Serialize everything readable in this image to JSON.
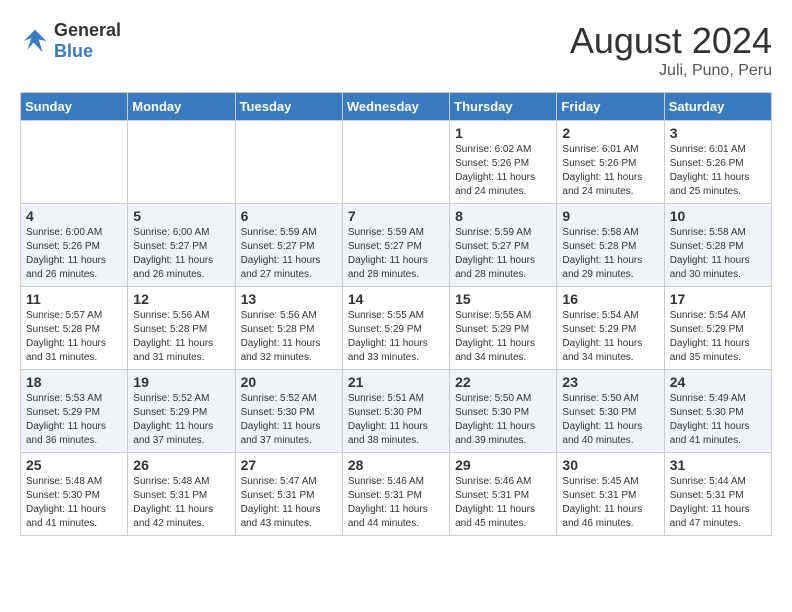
{
  "header": {
    "logo_general": "General",
    "logo_blue": "Blue",
    "month_year": "August 2024",
    "location": "Juli, Puno, Peru"
  },
  "columns": [
    "Sunday",
    "Monday",
    "Tuesday",
    "Wednesday",
    "Thursday",
    "Friday",
    "Saturday"
  ],
  "weeks": [
    [
      {
        "day": "",
        "info": ""
      },
      {
        "day": "",
        "info": ""
      },
      {
        "day": "",
        "info": ""
      },
      {
        "day": "",
        "info": ""
      },
      {
        "day": "1",
        "info": "Sunrise: 6:02 AM\nSunset: 5:26 PM\nDaylight: 11 hours and 24 minutes."
      },
      {
        "day": "2",
        "info": "Sunrise: 6:01 AM\nSunset: 5:26 PM\nDaylight: 11 hours and 24 minutes."
      },
      {
        "day": "3",
        "info": "Sunrise: 6:01 AM\nSunset: 5:26 PM\nDaylight: 11 hours and 25 minutes."
      }
    ],
    [
      {
        "day": "4",
        "info": "Sunrise: 6:00 AM\nSunset: 5:26 PM\nDaylight: 11 hours and 26 minutes."
      },
      {
        "day": "5",
        "info": "Sunrise: 6:00 AM\nSunset: 5:27 PM\nDaylight: 11 hours and 26 minutes."
      },
      {
        "day": "6",
        "info": "Sunrise: 5:59 AM\nSunset: 5:27 PM\nDaylight: 11 hours and 27 minutes."
      },
      {
        "day": "7",
        "info": "Sunrise: 5:59 AM\nSunset: 5:27 PM\nDaylight: 11 hours and 28 minutes."
      },
      {
        "day": "8",
        "info": "Sunrise: 5:59 AM\nSunset: 5:27 PM\nDaylight: 11 hours and 28 minutes."
      },
      {
        "day": "9",
        "info": "Sunrise: 5:58 AM\nSunset: 5:28 PM\nDaylight: 11 hours and 29 minutes."
      },
      {
        "day": "10",
        "info": "Sunrise: 5:58 AM\nSunset: 5:28 PM\nDaylight: 11 hours and 30 minutes."
      }
    ],
    [
      {
        "day": "11",
        "info": "Sunrise: 5:57 AM\nSunset: 5:28 PM\nDaylight: 11 hours and 31 minutes."
      },
      {
        "day": "12",
        "info": "Sunrise: 5:56 AM\nSunset: 5:28 PM\nDaylight: 11 hours and 31 minutes."
      },
      {
        "day": "13",
        "info": "Sunrise: 5:56 AM\nSunset: 5:28 PM\nDaylight: 11 hours and 32 minutes."
      },
      {
        "day": "14",
        "info": "Sunrise: 5:55 AM\nSunset: 5:29 PM\nDaylight: 11 hours and 33 minutes."
      },
      {
        "day": "15",
        "info": "Sunrise: 5:55 AM\nSunset: 5:29 PM\nDaylight: 11 hours and 34 minutes."
      },
      {
        "day": "16",
        "info": "Sunrise: 5:54 AM\nSunset: 5:29 PM\nDaylight: 11 hours and 34 minutes."
      },
      {
        "day": "17",
        "info": "Sunrise: 5:54 AM\nSunset: 5:29 PM\nDaylight: 11 hours and 35 minutes."
      }
    ],
    [
      {
        "day": "18",
        "info": "Sunrise: 5:53 AM\nSunset: 5:29 PM\nDaylight: 11 hours and 36 minutes."
      },
      {
        "day": "19",
        "info": "Sunrise: 5:52 AM\nSunset: 5:29 PM\nDaylight: 11 hours and 37 minutes."
      },
      {
        "day": "20",
        "info": "Sunrise: 5:52 AM\nSunset: 5:30 PM\nDaylight: 11 hours and 37 minutes."
      },
      {
        "day": "21",
        "info": "Sunrise: 5:51 AM\nSunset: 5:30 PM\nDaylight: 11 hours and 38 minutes."
      },
      {
        "day": "22",
        "info": "Sunrise: 5:50 AM\nSunset: 5:30 PM\nDaylight: 11 hours and 39 minutes."
      },
      {
        "day": "23",
        "info": "Sunrise: 5:50 AM\nSunset: 5:30 PM\nDaylight: 11 hours and 40 minutes."
      },
      {
        "day": "24",
        "info": "Sunrise: 5:49 AM\nSunset: 5:30 PM\nDaylight: 11 hours and 41 minutes."
      }
    ],
    [
      {
        "day": "25",
        "info": "Sunrise: 5:48 AM\nSunset: 5:30 PM\nDaylight: 11 hours and 41 minutes."
      },
      {
        "day": "26",
        "info": "Sunrise: 5:48 AM\nSunset: 5:31 PM\nDaylight: 11 hours and 42 minutes."
      },
      {
        "day": "27",
        "info": "Sunrise: 5:47 AM\nSunset: 5:31 PM\nDaylight: 11 hours and 43 minutes."
      },
      {
        "day": "28",
        "info": "Sunrise: 5:46 AM\nSunset: 5:31 PM\nDaylight: 11 hours and 44 minutes."
      },
      {
        "day": "29",
        "info": "Sunrise: 5:46 AM\nSunset: 5:31 PM\nDaylight: 11 hours and 45 minutes."
      },
      {
        "day": "30",
        "info": "Sunrise: 5:45 AM\nSunset: 5:31 PM\nDaylight: 11 hours and 46 minutes."
      },
      {
        "day": "31",
        "info": "Sunrise: 5:44 AM\nSunset: 5:31 PM\nDaylight: 11 hours and 47 minutes."
      }
    ]
  ]
}
